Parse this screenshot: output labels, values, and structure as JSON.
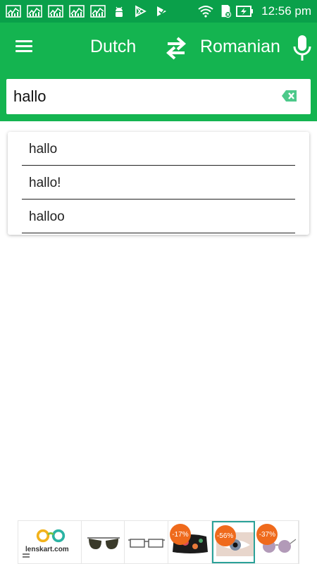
{
  "status_bar": {
    "time": "12:56 pm",
    "icons": [
      "stats-icon",
      "stats-icon",
      "stats-icon",
      "stats-icon",
      "stats-icon",
      "android-icon",
      "play-store-icon",
      "play-store-alt-icon"
    ],
    "right_icons": [
      "wifi-icon",
      "sd-card-icon",
      "battery-charging-icon"
    ]
  },
  "toolbar": {
    "menu_icon": "hamburger-menu-icon",
    "source_language": "Dutch",
    "swap_icon": "swap-arrows-icon",
    "target_language": "Romanian",
    "mic_icon": "microphone-icon"
  },
  "search": {
    "value": "hallo",
    "clear_icon": "backspace-clear-icon"
  },
  "suggestions": [
    {
      "label": "hallo"
    },
    {
      "label": "hallo!"
    },
    {
      "label": "halloo"
    }
  ],
  "ad_banner": {
    "logo_text": "lenskart.com",
    "tiles": [
      {
        "image": "aviator-sunglasses",
        "discount": ""
      },
      {
        "image": "rectangular-eyeglasses",
        "discount": ""
      },
      {
        "image": "floral-glasses-case",
        "discount": "-17%"
      },
      {
        "image": "eye-closeup",
        "discount": "-56%"
      },
      {
        "image": "round-sunglasses",
        "discount": "-37%"
      }
    ]
  },
  "colors": {
    "status_bar": "#0aa04a",
    "primary": "#14b450",
    "discount_badge": "#ef6a1c",
    "selected_tile_border": "#2aa198"
  }
}
